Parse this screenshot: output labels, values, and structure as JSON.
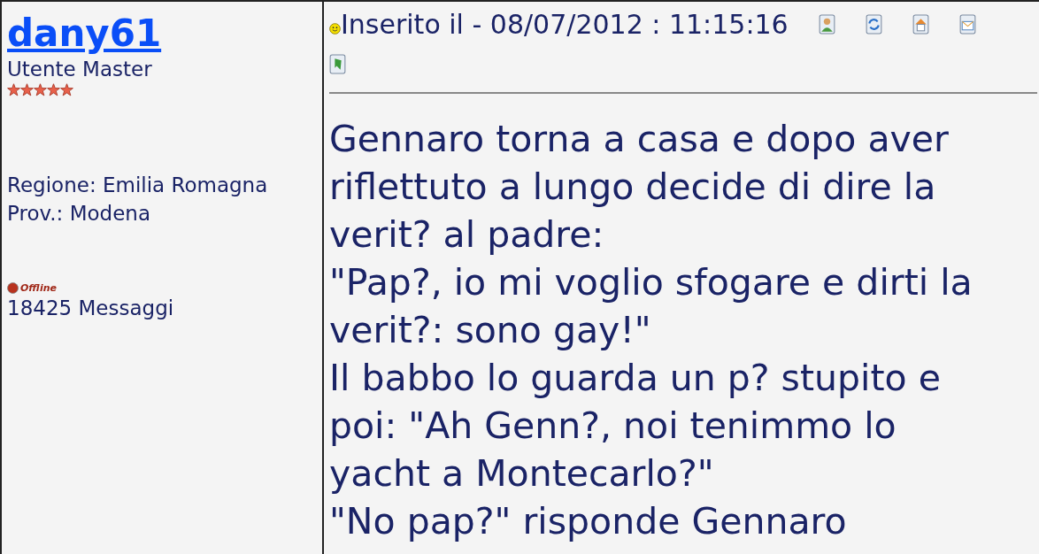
{
  "author": {
    "name": "dany61",
    "rank": "Utente Master",
    "stars": 5,
    "region": "Regione: Emilia Romagna",
    "province": "Prov.: Modena",
    "online": false,
    "status_label": "Offline",
    "posts": "18425 Messaggi"
  },
  "post": {
    "posted": "Inserito il - 08/07/2012 : 11:15:16",
    "paragraphs": [
      "Gennaro torna a casa e dopo aver riflettuto a lungo decide di dire la verit? al padre:",
      "\"Pap?, io mi voglio sfogare e dirti la verit?: sono gay!\"",
      "Il babbo lo guarda un p? stupito e poi: \"Ah Genn?, noi tenimmo lo yacht a Montecarlo?\"",
      "\"No pap?\" risponde Gennaro"
    ]
  }
}
